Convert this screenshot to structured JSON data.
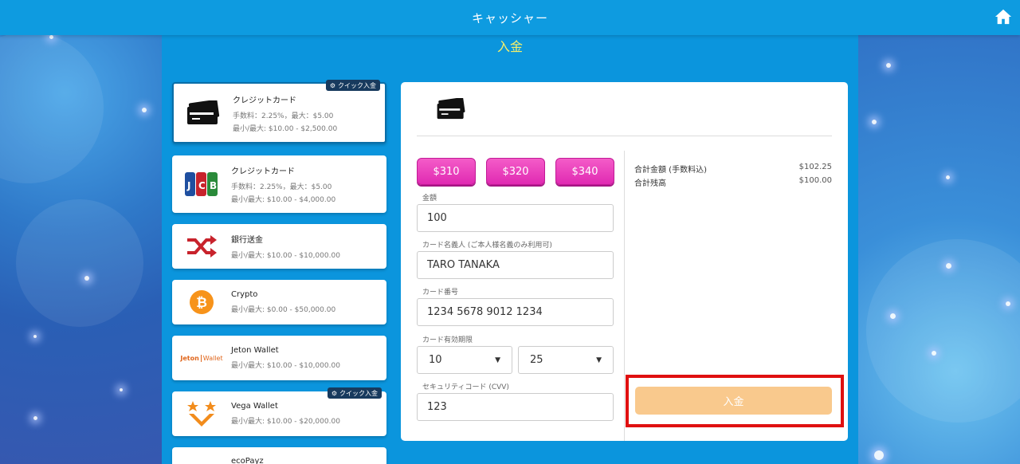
{
  "header": {
    "title": "キャッシャー"
  },
  "page": {
    "heading": "入金"
  },
  "methods": [
    {
      "name": "クレジットカード",
      "line1": "手数料：2.25%，最大：$5.00",
      "line2": "最小/最大: $10.00 - $2,500.00",
      "badge": "クイック入金",
      "logo": "credit-card-icon"
    },
    {
      "name": "クレジットカード",
      "line1": "手数料：2.25%，最大：$5.00",
      "line2": "最小/最大: $10.00 - $4,000.00",
      "logo": "jcb-logo"
    },
    {
      "name": "銀行送金",
      "line1": "最小/最大: $10.00 - $10,000.00",
      "logo": "shuffle-arrows-icon"
    },
    {
      "name": "Crypto",
      "line1": "最小/最大: $0.00 - $50,000.00",
      "logo": "bitcoin-icon"
    },
    {
      "name": "Jeton Wallet",
      "line1": "最小/最大: $10.00 - $10,000.00",
      "logo": "jeton-wallet-logo",
      "logo_text": "Jeton",
      "logo_text2": "Wallet"
    },
    {
      "name": "Vega Wallet",
      "line1": "最小/最大: $10.00 - $20,000.00",
      "badge": "クイック入金",
      "logo": "vega-wallet-logo"
    },
    {
      "name": "ecoPayz",
      "logo": "ecopayz-logo"
    }
  ],
  "amount_buttons": [
    "$310",
    "$320",
    "$340"
  ],
  "form": {
    "amount_label": "金額",
    "amount_value": "100",
    "holder_label": "カード名義人 (ご本人様名義のみ利用可)",
    "holder_value": "TARO TANAKA",
    "number_label": "カード番号",
    "number_value": "1234 5678 9012 1234",
    "expiry_label": "カード有効期限",
    "expiry_month": "10",
    "expiry_year": "25",
    "cvv_label": "セキュリティコード (CVV)",
    "cvv_value": "123"
  },
  "summary": {
    "total_label": "合計金額 (手数料込)",
    "total_value": "$102.25",
    "balance_label": "合計残高",
    "balance_value": "$100.00"
  },
  "submit_label": "入金",
  "colors": {
    "accent_pink": "#e02ab2",
    "heading_yellow": "#f5f06a",
    "submit_disabled": "#f9c98d",
    "highlight_red": "#e01010"
  }
}
